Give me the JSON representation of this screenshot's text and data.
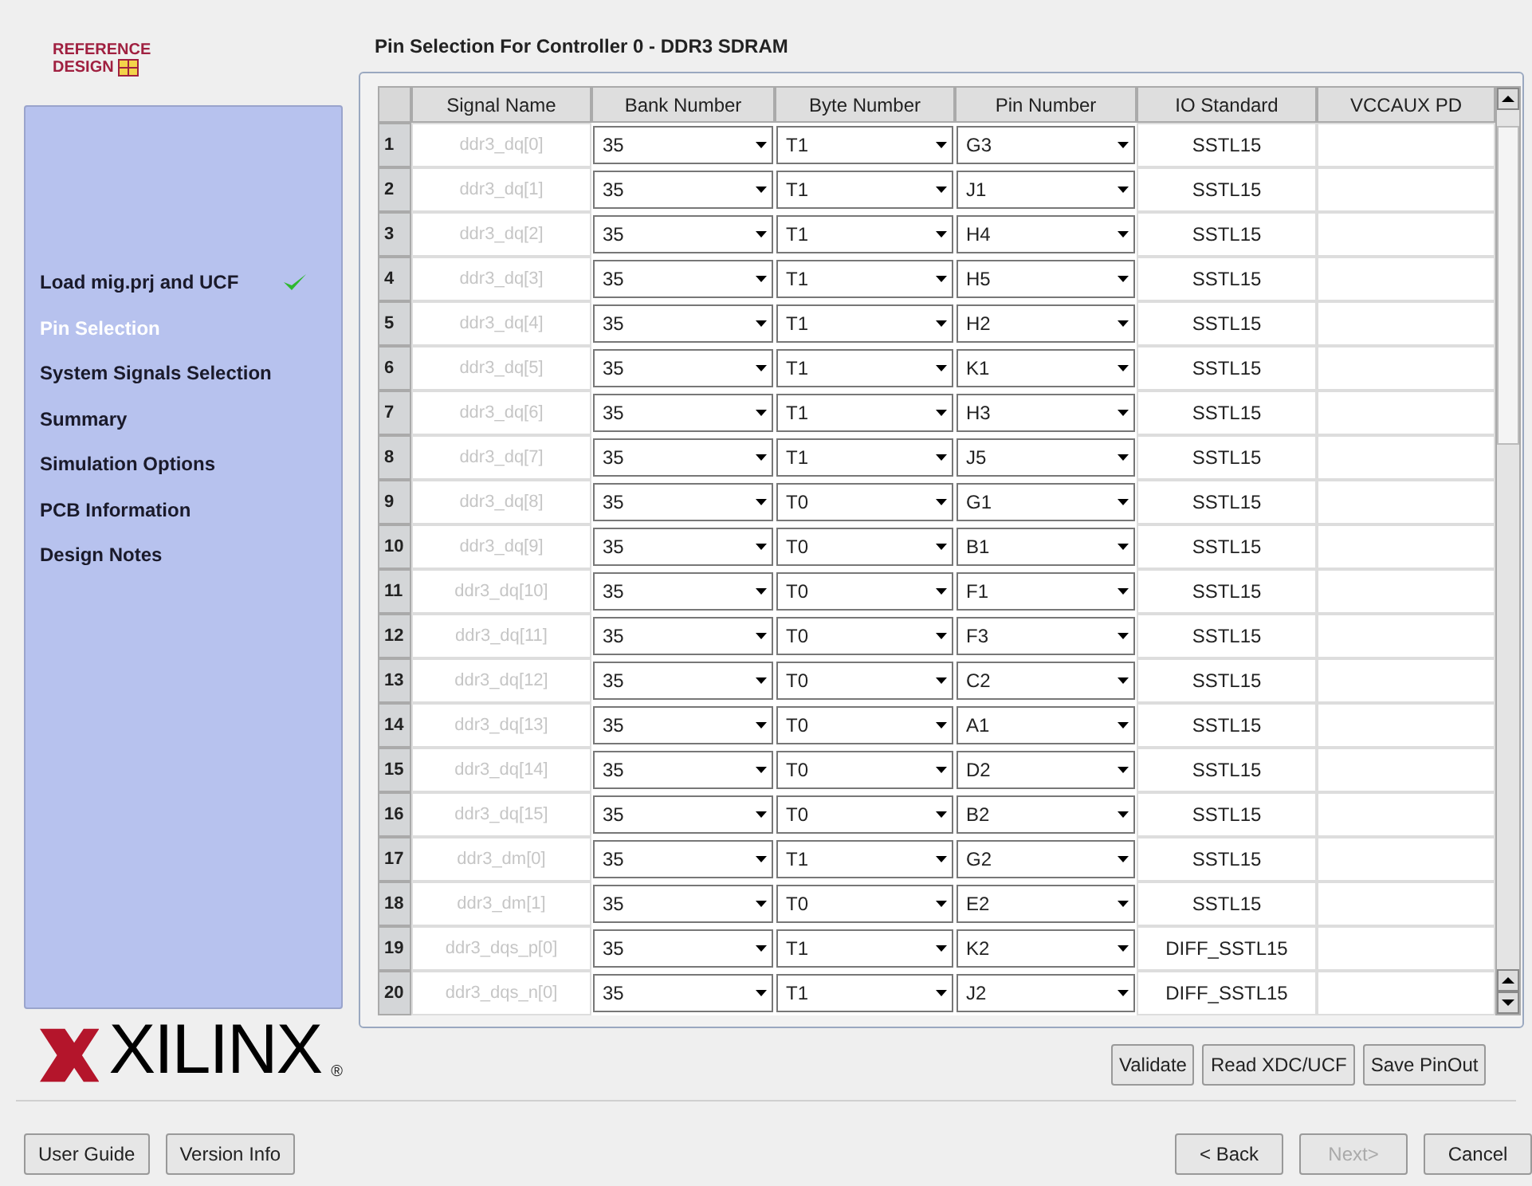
{
  "logo": {
    "line_1": "REFERENCE",
    "line_2": "DESIGN"
  },
  "steps": [
    {
      "label": "Load mig.prj and UCF",
      "selected": false,
      "checked": true
    },
    {
      "label": "Pin Selection",
      "selected": true,
      "checked": false
    },
    {
      "label": "System Signals Selection",
      "selected": false,
      "checked": false
    },
    {
      "label": "Summary",
      "selected": false,
      "checked": false
    },
    {
      "label": "Simulation Options",
      "selected": false,
      "checked": false
    },
    {
      "label": "PCB Information",
      "selected": false,
      "checked": false
    },
    {
      "label": "Design Notes",
      "selected": false,
      "checked": false
    }
  ],
  "brand": {
    "name": "XILINX",
    "mark": "®"
  },
  "title": "Pin Selection For Controller 0 - DDR3 SDRAM",
  "table": {
    "columns": [
      "Signal Name",
      "Bank Number",
      "Byte Number",
      "Pin Number",
      "IO Standard",
      "VCCAUX PD"
    ],
    "rows": [
      {
        "index": "1",
        "signal": "ddr3_dq[0]",
        "disabled": true,
        "bank": "35",
        "byte": "T1",
        "pin": "G3",
        "io_standard": "SSTL15"
      },
      {
        "index": "2",
        "signal": "ddr3_dq[1]",
        "disabled": true,
        "bank": "35",
        "byte": "T1",
        "pin": "J1",
        "io_standard": "SSTL15"
      },
      {
        "index": "3",
        "signal": "ddr3_dq[2]",
        "disabled": true,
        "bank": "35",
        "byte": "T1",
        "pin": "H4",
        "io_standard": "SSTL15"
      },
      {
        "index": "4",
        "signal": "ddr3_dq[3]",
        "disabled": true,
        "bank": "35",
        "byte": "T1",
        "pin": "H5",
        "io_standard": "SSTL15"
      },
      {
        "index": "5",
        "signal": "ddr3_dq[4]",
        "disabled": true,
        "bank": "35",
        "byte": "T1",
        "pin": "H2",
        "io_standard": "SSTL15"
      },
      {
        "index": "6",
        "signal": "ddr3_dq[5]",
        "disabled": true,
        "bank": "35",
        "byte": "T1",
        "pin": "K1",
        "io_standard": "SSTL15"
      },
      {
        "index": "7",
        "signal": "ddr3_dq[6]",
        "disabled": true,
        "bank": "35",
        "byte": "T1",
        "pin": "H3",
        "io_standard": "SSTL15"
      },
      {
        "index": "8",
        "signal": "ddr3_dq[7]",
        "disabled": true,
        "bank": "35",
        "byte": "T1",
        "pin": "J5",
        "io_standard": "SSTL15"
      },
      {
        "index": "9",
        "signal": "ddr3_dq[8]",
        "disabled": true,
        "bank": "35",
        "byte": "T0",
        "pin": "G1",
        "io_standard": "SSTL15"
      },
      {
        "index": "10",
        "signal": "ddr3_dq[9]",
        "disabled": true,
        "bank": "35",
        "byte": "T0",
        "pin": "B1",
        "io_standard": "SSTL15"
      },
      {
        "index": "11",
        "signal": "ddr3_dq[10]",
        "disabled": true,
        "bank": "35",
        "byte": "T0",
        "pin": "F1",
        "io_standard": "SSTL15"
      },
      {
        "index": "12",
        "signal": "ddr3_dq[11]",
        "disabled": true,
        "bank": "35",
        "byte": "T0",
        "pin": "F3",
        "io_standard": "SSTL15"
      },
      {
        "index": "13",
        "signal": "ddr3_dq[12]",
        "disabled": true,
        "bank": "35",
        "byte": "T0",
        "pin": "C2",
        "io_standard": "SSTL15"
      },
      {
        "index": "14",
        "signal": "ddr3_dq[13]",
        "disabled": true,
        "bank": "35",
        "byte": "T0",
        "pin": "A1",
        "io_standard": "SSTL15"
      },
      {
        "index": "15",
        "signal": "ddr3_dq[14]",
        "disabled": true,
        "bank": "35",
        "byte": "T0",
        "pin": "D2",
        "io_standard": "SSTL15"
      },
      {
        "index": "16",
        "signal": "ddr3_dq[15]",
        "disabled": true,
        "bank": "35",
        "byte": "T0",
        "pin": "B2",
        "io_standard": "SSTL15"
      },
      {
        "index": "17",
        "signal": "ddr3_dm[0]",
        "disabled": true,
        "bank": "35",
        "byte": "T1",
        "pin": "G2",
        "io_standard": "SSTL15"
      },
      {
        "index": "18",
        "signal": "ddr3_dm[1]",
        "disabled": true,
        "bank": "35",
        "byte": "T0",
        "pin": "E2",
        "io_standard": "SSTL15"
      },
      {
        "index": "19",
        "signal": "ddr3_dqs_p[0]",
        "disabled": true,
        "bank": "35",
        "byte": "T1",
        "pin": "K2",
        "io_standard": "DIFF_SSTL15"
      },
      {
        "index": "20",
        "signal": "ddr3_dqs_n[0]",
        "disabled": true,
        "bank": "35",
        "byte": "T1",
        "pin": "J2",
        "io_standard": "DIFF_SSTL15"
      }
    ]
  },
  "actions": [
    {
      "label": "Validate"
    },
    {
      "label": "Read XDC/UCF"
    },
    {
      "label": "Save PinOut"
    }
  ],
  "footer_left": [
    {
      "label": "User Guide"
    },
    {
      "label": "Version Info"
    }
  ],
  "footer_right": [
    {
      "label": "< Back",
      "disabled": false
    },
    {
      "label": "Next>",
      "disabled": true
    },
    {
      "label": "Cancel",
      "disabled": false
    }
  ]
}
